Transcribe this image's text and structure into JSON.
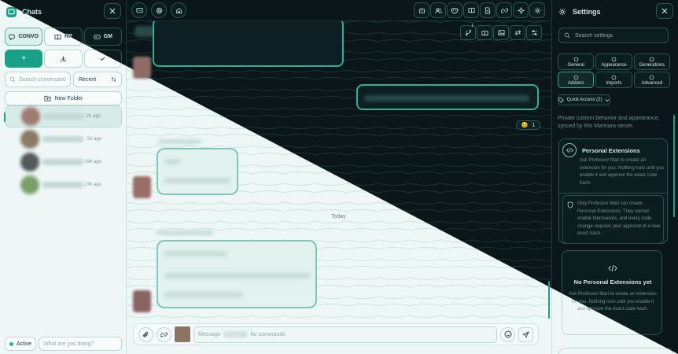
{
  "sidebar": {
    "title": "Chats",
    "mode_tabs": [
      {
        "label": "CONVO",
        "icon": "chat-bubble-icon"
      },
      {
        "label": "RP",
        "icon": "book-open-icon"
      },
      {
        "label": "GM",
        "icon": "game-controller-icon"
      }
    ],
    "new_chat_label": "+",
    "search_placeholder": "Search conversations",
    "sort_value": "Recent",
    "new_folder_label": "New Folder",
    "chats": [
      {
        "time": "2h ago",
        "avatar_color": "#a07a72"
      },
      {
        "time": "2h ago",
        "avatar_color": "#8a7a66"
      },
      {
        "time": "19h ago",
        "avatar_color": "#545a5c"
      },
      {
        "time": "23h ago",
        "avatar_color": "#7aa06a"
      }
    ],
    "status_label": "Active",
    "status_placeholder": "What are you doing?"
  },
  "main": {
    "today_label": "Today",
    "reaction_emoji": "😣",
    "reaction_count": "1",
    "composer_prefix": "Message",
    "composer_suffix": "for commands"
  },
  "settings": {
    "title": "Settings",
    "search_placeholder": "Search settings",
    "tabs": [
      {
        "label": "General",
        "icon": "sliders-icon"
      },
      {
        "label": "Appearance",
        "icon": "palette-icon"
      },
      {
        "label": "Generations",
        "icon": "sparkle-icon"
      },
      {
        "label": "Addons",
        "icon": "puzzle-icon"
      },
      {
        "label": "Imports",
        "icon": "download-icon"
      },
      {
        "label": "Advanced",
        "icon": "wrench-icon"
      }
    ],
    "quick_access_label": "Quick Access (2)",
    "description": "Private custom behavior and appearance, synced by this Marinara server.",
    "ext_title": "Personal Extensions",
    "ext_text": "Ask Professor Mari to create an extension for you. Nothing runs until you enable it and approve the exact code hash.",
    "ext_note": "Only Professor Mari can create Personal Extensions. They cannot enable themselves, and every code change requires your approval of a new exact hash.",
    "empty_title": "No Personal Extensions yet",
    "empty_text": "Ask Professor Mari to create an extension for you. Nothing runs until you enable it and approve the exact code hash."
  },
  "colors": {
    "accent": "#18a089",
    "light_bg": "#eef7f6",
    "dark_bg": "#0a1619",
    "status_online": "#1fbf7a"
  }
}
